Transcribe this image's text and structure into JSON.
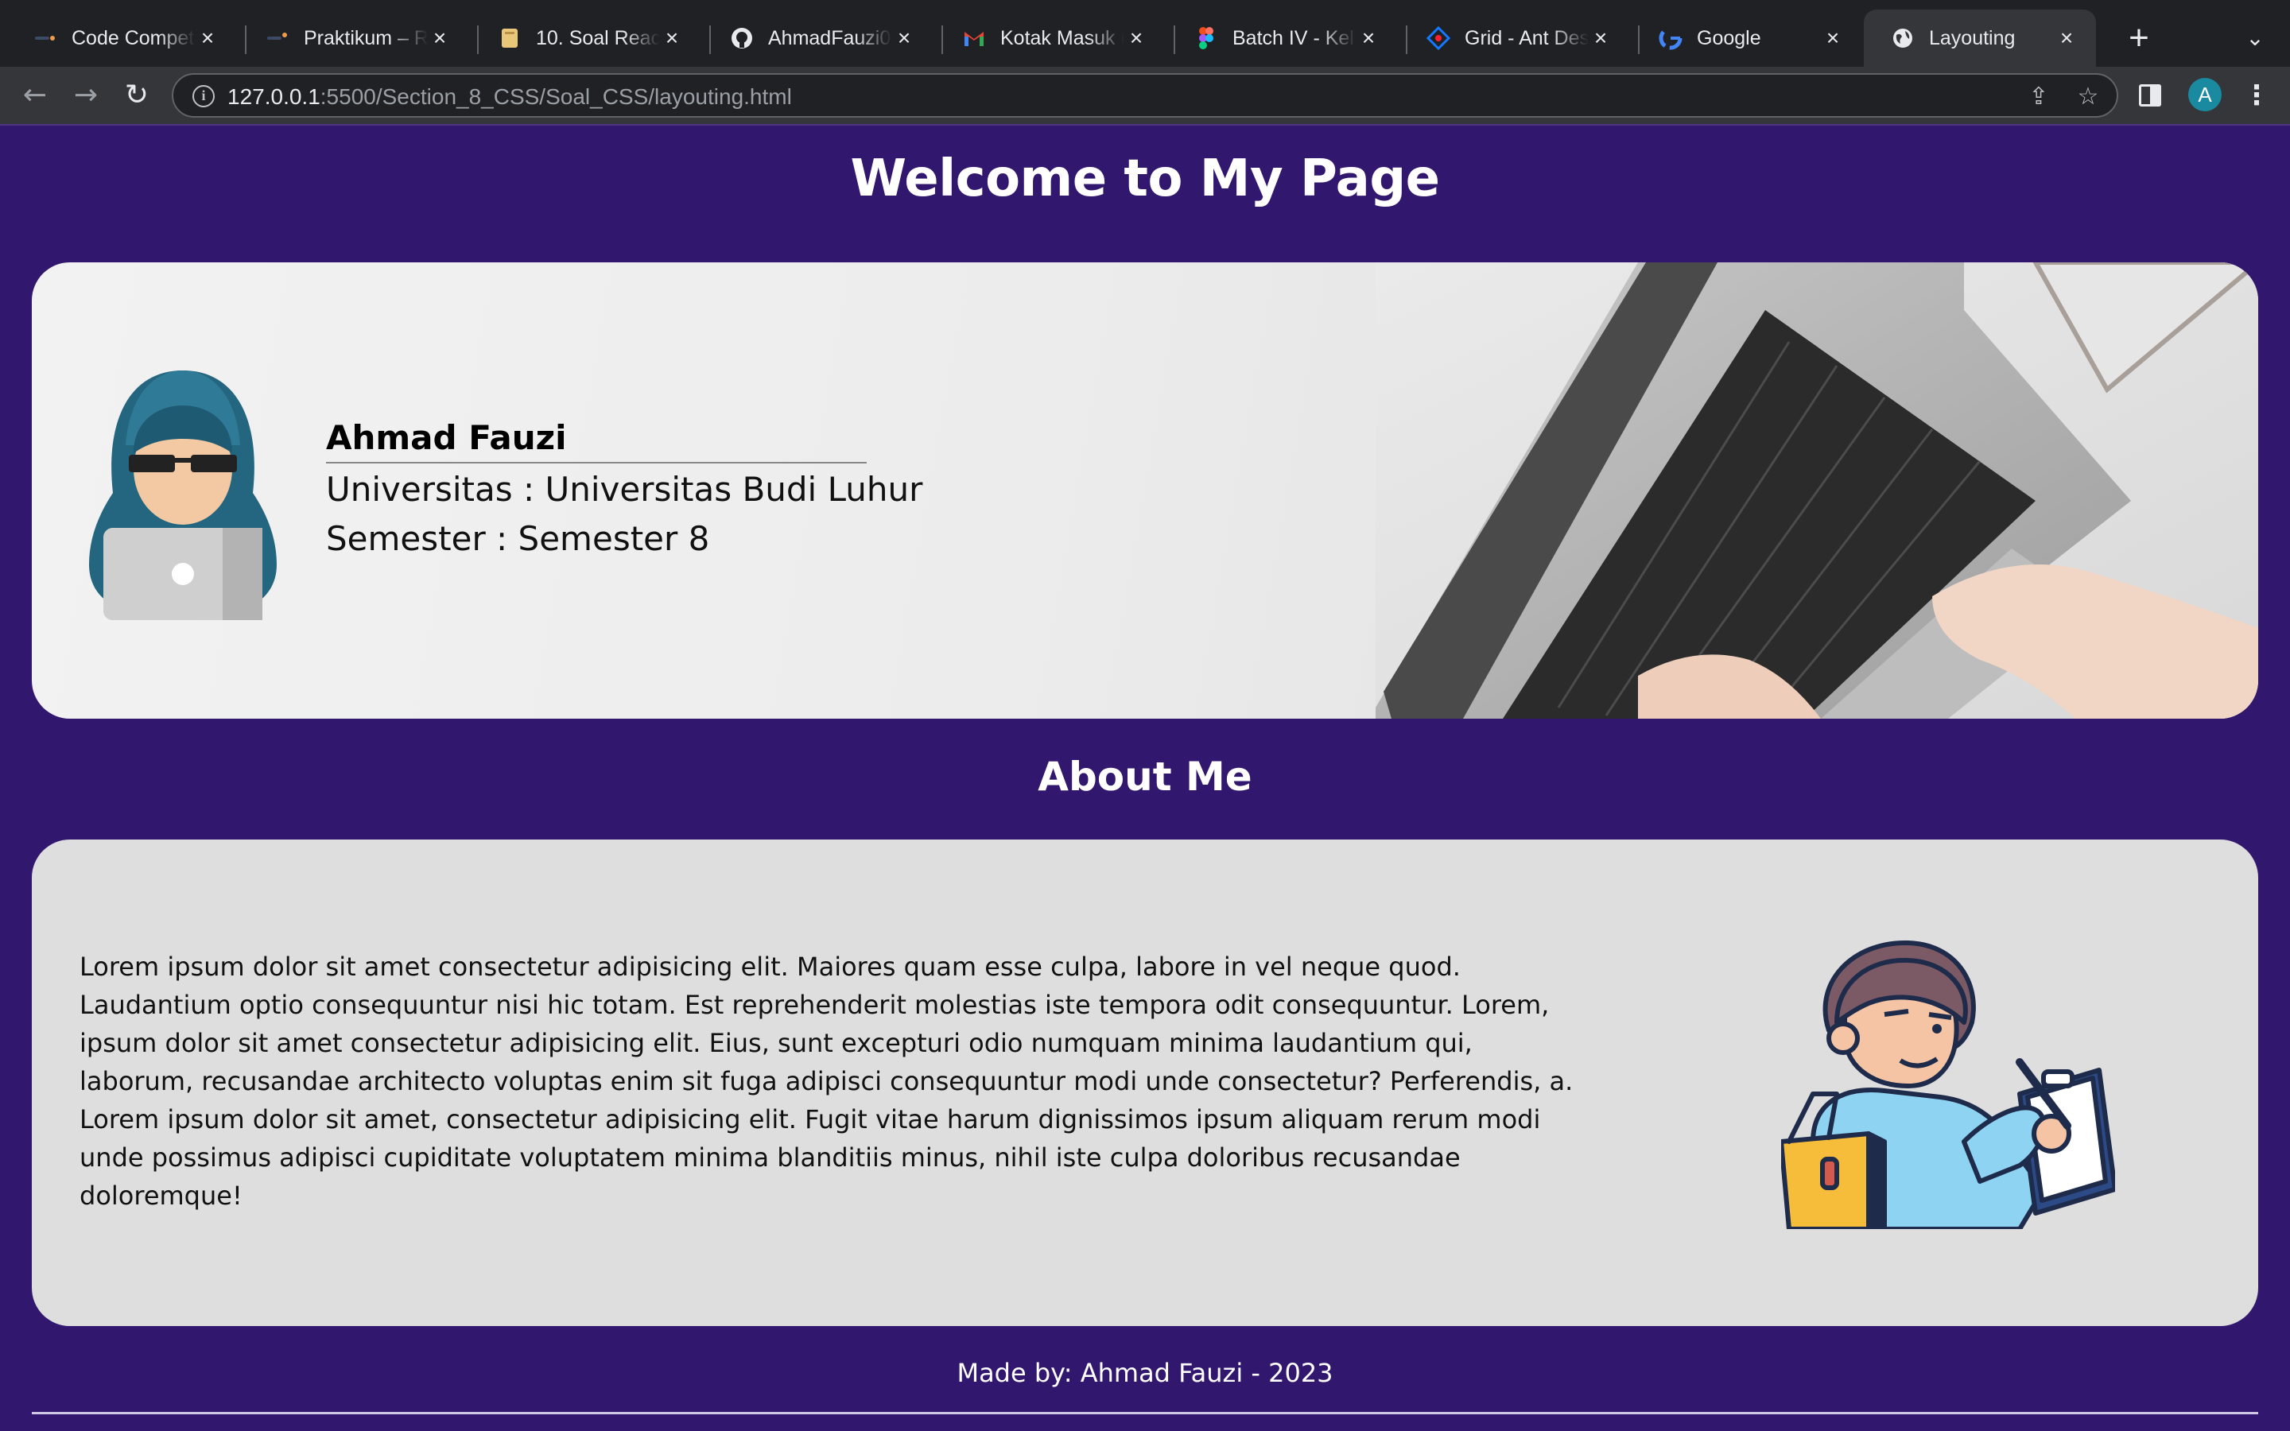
{
  "browser": {
    "tabs": [
      {
        "title": "Code Competence",
        "favicon": "dark-logo-icon",
        "active": false
      },
      {
        "title": "Praktikum – React",
        "favicon": "dark-logo-icon",
        "active": false
      },
      {
        "title": "10. Soal React",
        "favicon": "notebook-icon",
        "active": false
      },
      {
        "title": "AhmadFauzi07",
        "favicon": "github-icon",
        "active": false
      },
      {
        "title": "Kotak Masuk (",
        "favicon": "gmail-icon",
        "active": false
      },
      {
        "title": "Batch IV - Kel",
        "favicon": "figma-icon",
        "active": false
      },
      {
        "title": "Grid - Ant Des",
        "favicon": "antd-icon",
        "active": false
      },
      {
        "title": "Google",
        "favicon": "google-icon",
        "active": false
      },
      {
        "title": "Layouting",
        "favicon": "globe-icon",
        "active": true
      }
    ],
    "url_host": "127.0.0.1",
    "url_path": ":5500/Section_8_CSS/Soal_CSS/layouting.html",
    "profile_initial": "A",
    "profile_color": "#1a8aa0"
  },
  "page": {
    "title": "Welcome to My Page",
    "background": "#32176f",
    "profile": {
      "name": "Ahmad Fauzi",
      "university": "Universitas : Universitas Budi Luhur",
      "semester": "Semester : Semester 8"
    },
    "about_title": "About Me",
    "about_text": "Lorem ipsum dolor sit amet consectetur adipisicing elit. Maiores quam esse culpa, labore in vel neque quod. Laudantium optio consequuntur nisi hic totam. Est reprehenderit molestias iste tempora odit consequuntur. Lorem, ipsum dolor sit amet consectetur adipisicing elit. Eius, sunt excepturi odio numquam minima laudantium qui, laborum, recusandae architecto voluptas enim sit fuga adipisci consequuntur modi unde consectetur? Perferendis, a. Lorem ipsum dolor sit amet, consectetur adipisicing elit. Fugit vitae harum dignissimos ipsum aliquam rerum modi unde possimus adipisci cupiditate voluptatem minima blanditiis minus, nihil iste culpa doloribus recusandae doloremque!",
    "footer": "Made by: Ahmad Fauzi - 2023"
  }
}
